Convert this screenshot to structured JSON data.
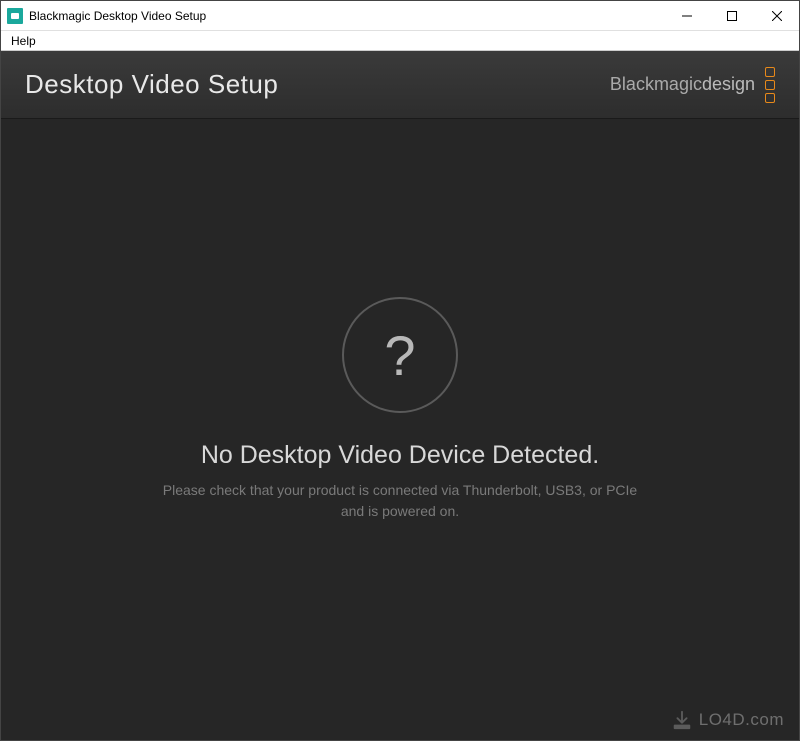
{
  "titlebar": {
    "title": "Blackmagic Desktop Video Setup"
  },
  "menubar": {
    "help": "Help"
  },
  "header": {
    "title": "Desktop Video Setup",
    "brand_prefix": "Blackmagic",
    "brand_suffix": "design"
  },
  "content": {
    "icon_glyph": "?",
    "heading": "No Desktop Video Device Detected.",
    "subtext": "Please check that your product is connected via Thunderbolt, USB3, or PCIe and is powered on."
  },
  "watermark": {
    "text": "LO4D.com"
  }
}
